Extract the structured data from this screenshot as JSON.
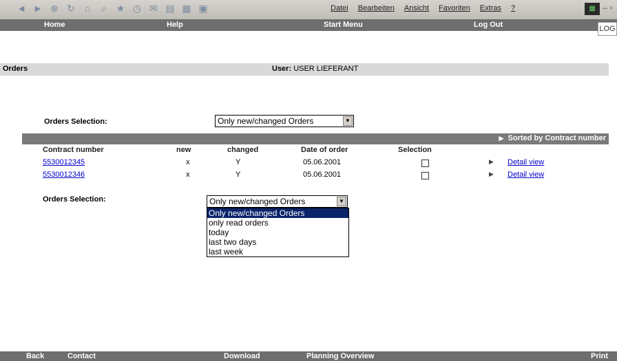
{
  "browser": {
    "menu": [
      "Datei",
      "Bearbeiten",
      "Ansicht",
      "Favoriten",
      "Extras",
      "?"
    ],
    "toolbar_icons": [
      "back-icon",
      "forward-icon",
      "stop-icon",
      "refresh-icon",
      "home-icon",
      "search-icon",
      "favorites-icon",
      "history-icon",
      "mail-icon",
      "print-icon",
      "edit-icon",
      "discuss-icon"
    ]
  },
  "topnav": {
    "home": "Home",
    "help": "Help",
    "start_menu": "Start Menu",
    "log_out": "Log Out",
    "logo": "LOG"
  },
  "titlebar": {
    "title": "Orders",
    "user_label": "User:",
    "user_value": "USER LIEFERANT"
  },
  "selection_top": {
    "label": "Orders Selection:",
    "value": "Only new/changed Orders"
  },
  "grid": {
    "sort_label": "Sorted by Contract number",
    "columns": [
      "Contract number",
      "new",
      "changed",
      "Date of order",
      "Selection"
    ],
    "rows": [
      {
        "contract": "5530012345",
        "new": "x",
        "changed": "Y",
        "date": "05.06.2001",
        "detail": "Detail view"
      },
      {
        "contract": "5530012346",
        "new": "x",
        "changed": "Y",
        "date": "05.06.2001",
        "detail": "Detail view"
      }
    ]
  },
  "selection_bottom": {
    "label": "Orders Selection:",
    "value": "Only new/changed Orders",
    "options": [
      "Only new/changed Orders",
      "only read orders",
      "today",
      "last two days",
      "last week"
    ]
  },
  "footer": {
    "back": "Back",
    "contact": "Contact",
    "download": "Download",
    "planning": "Planning Overview",
    "print": "Print"
  }
}
